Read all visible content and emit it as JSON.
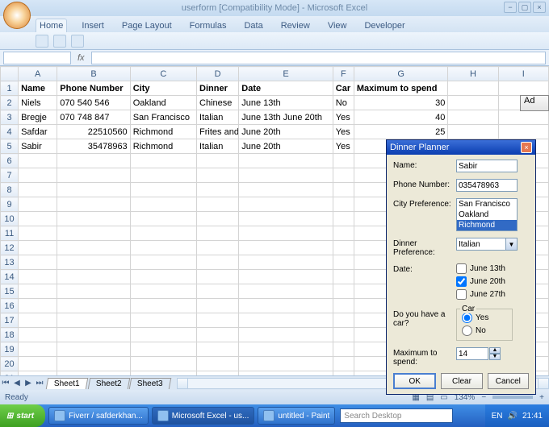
{
  "window": {
    "title": "userform  [Compatibility Mode] - Microsoft Excel"
  },
  "ribbon": {
    "tabs": [
      "Home",
      "Insert",
      "Page Layout",
      "Formulas",
      "Data",
      "Review",
      "View",
      "Developer"
    ]
  },
  "namebox": "",
  "sheet": {
    "columns": [
      "A",
      "B",
      "C",
      "D",
      "E",
      "F",
      "G",
      "H",
      "I"
    ],
    "headers": [
      "Name",
      "Phone Number",
      "City",
      "Dinner",
      "Date",
      "Car",
      "Maximum to spend"
    ],
    "rows": [
      {
        "name": "Niels",
        "phone": "070 540 546",
        "city": "Oakland",
        "dinner": "Chinese",
        "date": "June 13th",
        "car": "No",
        "max": "30"
      },
      {
        "name": "Bregje",
        "phone": "070 748 847",
        "city": "San Francisco",
        "dinner": "Italian",
        "date": "June 13th June 20th",
        "car": "Yes",
        "max": "40"
      },
      {
        "name": "Safdar",
        "phone": "22510560",
        "city": "Richmond",
        "dinner": "Frites and",
        "date": "June 20th",
        "car": "Yes",
        "max": "25"
      },
      {
        "name": "Sabir",
        "phone": "35478963",
        "city": "Richmond",
        "dinner": "Italian",
        "date": "June 20th",
        "car": "Yes",
        "max": "14"
      }
    ],
    "addbtn": "Ad",
    "tabs": [
      "Sheet1",
      "Sheet2",
      "Sheet3"
    ]
  },
  "statusbar": {
    "left": "Ready",
    "zoom": "134%"
  },
  "dialog": {
    "title": "Dinner Planner",
    "labels": {
      "name": "Name:",
      "phone": "Phone Number:",
      "city": "City Preference:",
      "dinner": "Dinner Preference:",
      "date": "Date:",
      "car": "Do you have a car?",
      "carlegend": "Car",
      "max": "Maximum to spend:"
    },
    "values": {
      "name": "Sabir",
      "phone": "035478963",
      "dinner": "Italian",
      "max": "14"
    },
    "cities": [
      "San Francisco",
      "Oakland",
      "Richmond"
    ],
    "dates": [
      "June 13th",
      "June 20th",
      "June 27th"
    ],
    "carOptions": [
      "Yes",
      "No"
    ],
    "buttons": {
      "ok": "OK",
      "clear": "Clear",
      "cancel": "Cancel"
    }
  },
  "taskbar": {
    "start": "start",
    "items": [
      "Fiverr / safderkhan...",
      "Microsoft Excel - us...",
      "untitled - Paint"
    ],
    "search": "Search Desktop",
    "lang": "EN",
    "time": "21:41"
  }
}
